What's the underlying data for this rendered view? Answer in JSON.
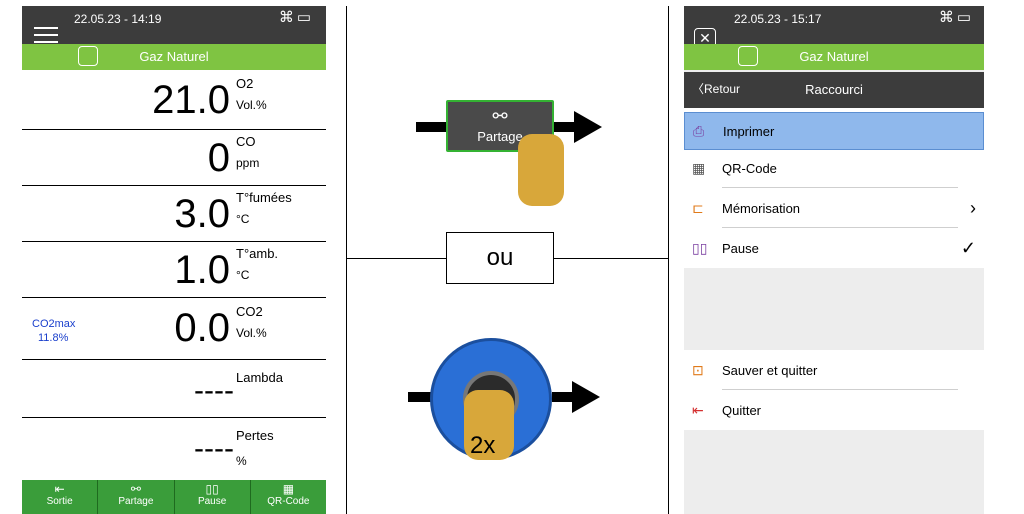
{
  "left_phone": {
    "status": {
      "datetime": "22.05.23 - 14:19"
    },
    "header": {
      "title": "Gaz Naturel"
    },
    "readings": [
      {
        "value": "21.0",
        "label": "O2",
        "unit": "Vol.%"
      },
      {
        "value": "0",
        "label": "CO",
        "unit": "ppm"
      },
      {
        "value": "3.0",
        "label": "T°fumées",
        "unit": "°C"
      },
      {
        "value": "1.0",
        "label": "T°amb.",
        "unit": "°C"
      },
      {
        "value": "0.0",
        "label": "CO2",
        "unit": "Vol.%"
      },
      {
        "value": "----",
        "label": "Lambda",
        "unit": ""
      },
      {
        "value": "----",
        "label": "Pertes",
        "unit": "%"
      }
    ],
    "co2max": {
      "label": "CO2max",
      "value": "11.8%"
    },
    "bottom_bar": [
      {
        "label": "Sortie",
        "icon": "exit-icon"
      },
      {
        "label": "Partage",
        "icon": "share-icon"
      },
      {
        "label": "Pause",
        "icon": "pause-icon"
      },
      {
        "label": "QR-Code",
        "icon": "qr-code-icon"
      }
    ]
  },
  "middle": {
    "share_button_label": "Partage",
    "or_label": "ou",
    "double_press_label": "2x"
  },
  "right_phone": {
    "status": {
      "datetime": "22.05.23 - 15:17"
    },
    "header": {
      "title": "Gaz Naturel"
    },
    "nav": {
      "back_label": "Retour",
      "title": "Raccourci"
    },
    "menu": [
      {
        "label": "Imprimer",
        "icon": "printer-icon",
        "selected": true
      },
      {
        "label": "QR-Code",
        "icon": "qr-code-icon"
      },
      {
        "label": "Mémorisation",
        "icon": "save-icon",
        "right": "chevron-right-icon"
      },
      {
        "label": "Pause",
        "icon": "pause-icon",
        "right": "check-circle-icon"
      }
    ],
    "menu2": [
      {
        "label": "Sauver et quitter",
        "icon": "save-exit-icon"
      },
      {
        "label": "Quitter",
        "icon": "exit-icon"
      }
    ]
  },
  "colors": {
    "green": "#7fc442",
    "dark": "#3c3c3c",
    "selected": "#8fb8ec",
    "accent_blue": "#1a3fcc",
    "dial_blue": "#2a6fd6",
    "hand": "#d8a73a"
  }
}
